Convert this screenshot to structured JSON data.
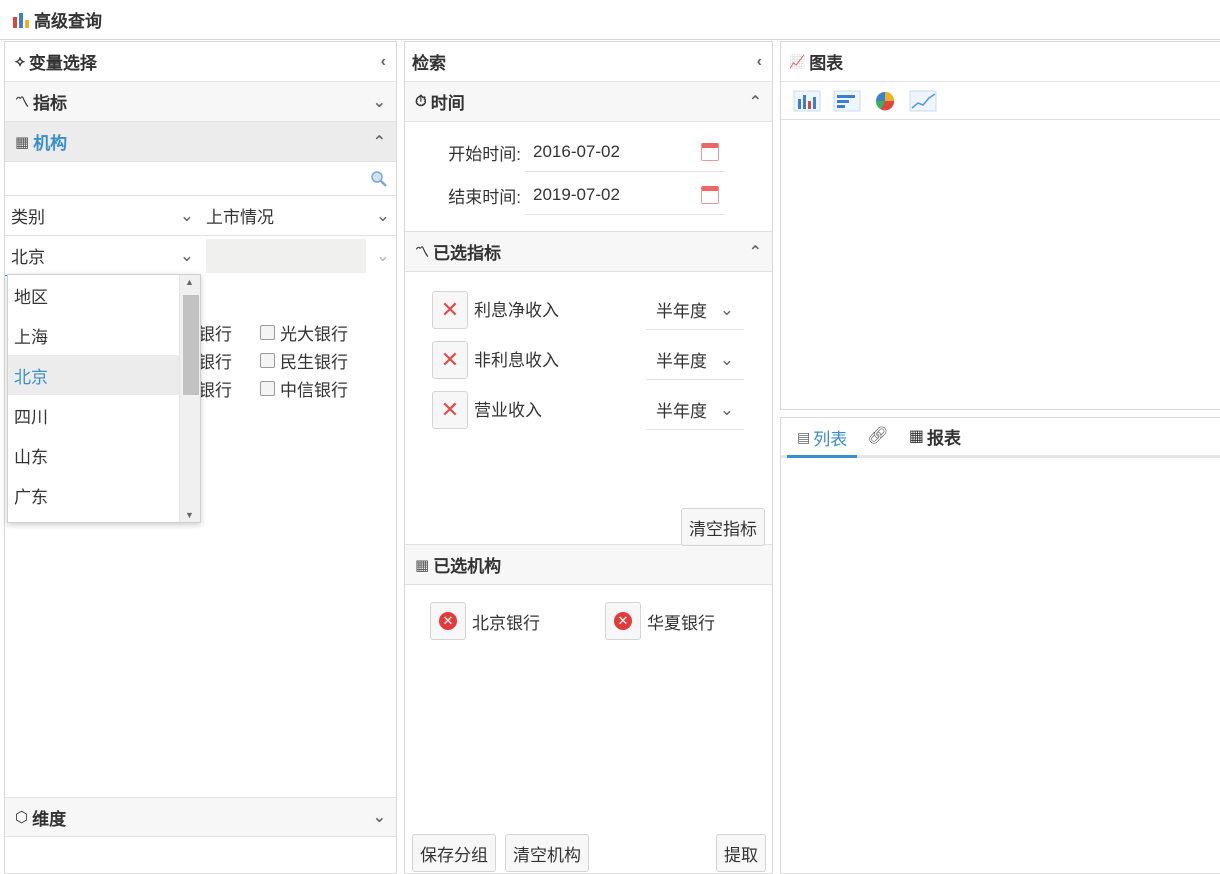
{
  "window": {
    "title": "高级查询"
  },
  "variable_panel": {
    "title": "变量选择",
    "sections": {
      "indicator": "指标",
      "institution": "机构",
      "dimension": "维度"
    },
    "filters": {
      "category": "类别",
      "listing": "上市情况",
      "region_value": "北京"
    },
    "dropdown_options": [
      "地区",
      "上海",
      "北京",
      "四川",
      "山东",
      "广东"
    ],
    "selected_option": "北京",
    "bank_partial": [
      "银行",
      "银行",
      "银行"
    ],
    "bank_checkboxes": [
      "光大银行",
      "民生银行",
      "中信银行"
    ]
  },
  "search_panel": {
    "title": "检索",
    "time_section": "时间",
    "start_label": "开始时间:",
    "start_value": "2016-07-02",
    "end_label": "结束时间:",
    "end_value": "2019-07-02",
    "selected_indicators_title": "已选指标",
    "indicators": [
      {
        "name": "利息净收入",
        "period": "半年度"
      },
      {
        "name": "非利息收入",
        "period": "半年度"
      },
      {
        "name": "营业收入",
        "period": "半年度"
      }
    ],
    "clear_indicators": "清空指标",
    "selected_institutions_title": "已选机构",
    "institutions": [
      "北京银行",
      "华夏银行"
    ],
    "save_group": "保存分组",
    "clear_institutions": "清空机构",
    "extract": "提取"
  },
  "chart_panel": {
    "title": "图表",
    "chart_types": [
      "bar-chart-icon",
      "horizontal-bar-icon",
      "pie-chart-icon",
      "line-chart-icon"
    ],
    "tabs": {
      "list": "列表",
      "report": "报表"
    }
  },
  "colors": {
    "accent": "#3a8ecb",
    "delete": "#e34b4b"
  }
}
